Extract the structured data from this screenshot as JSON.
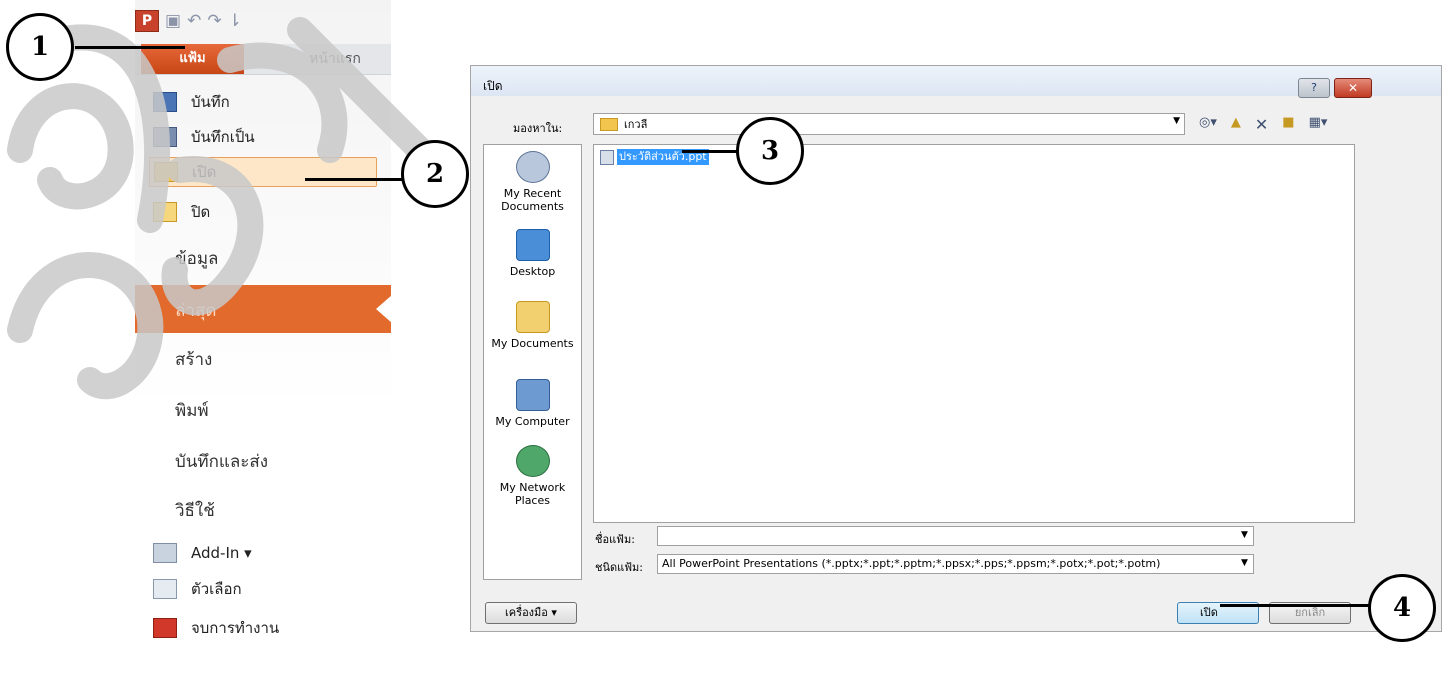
{
  "backstage": {
    "tabs": {
      "file": "แฟ้ม",
      "home": "หน้าแรก"
    },
    "menu": [
      {
        "label": "บันทึก"
      },
      {
        "label": "บันทึกเป็น"
      },
      {
        "label": "เปิด"
      },
      {
        "label": "ปิด"
      }
    ],
    "sections": {
      "info": "ข้อมูล",
      "recent": "ล่าสุด",
      "new": "สร้าง",
      "print": "พิมพ์",
      "save_send": "บันทึกและส่ง",
      "help": "วิธีใช้"
    },
    "bottom": [
      {
        "label": "Add-In ▾"
      },
      {
        "label": "ตัวเลือก"
      },
      {
        "label": "จบการทำงาน"
      }
    ]
  },
  "dialog": {
    "title": "เปิด",
    "help_button": "?",
    "close_button": "✕",
    "look_in_label": "มองหาใน:",
    "look_in_value": "เกวลี",
    "places": [
      {
        "label": "My Recent Documents"
      },
      {
        "label": "Desktop"
      },
      {
        "label": "My Documents"
      },
      {
        "label": "My Computer"
      },
      {
        "label": "My Network Places"
      }
    ],
    "file": "ประวัติส่วนตัว.ppt",
    "filename_label": "ชื่อแฟ้ม:",
    "filename_value": "",
    "filetype_label": "ชนิดแฟ้ม:",
    "filetype_value": "All PowerPoint Presentations (*.pptx;*.ppt;*.pptm;*.ppsx;*.pps;*.ppsm;*.potx;*.pot;*.potm)",
    "tools_button": "เครื่องมือ ▾",
    "open_button": "เปิด",
    "cancel_button": "ยกเลิก"
  },
  "callouts": [
    "1",
    "2",
    "3",
    "4"
  ],
  "colors": {
    "accent": "#e26a2d",
    "selection": "#3399ff"
  }
}
